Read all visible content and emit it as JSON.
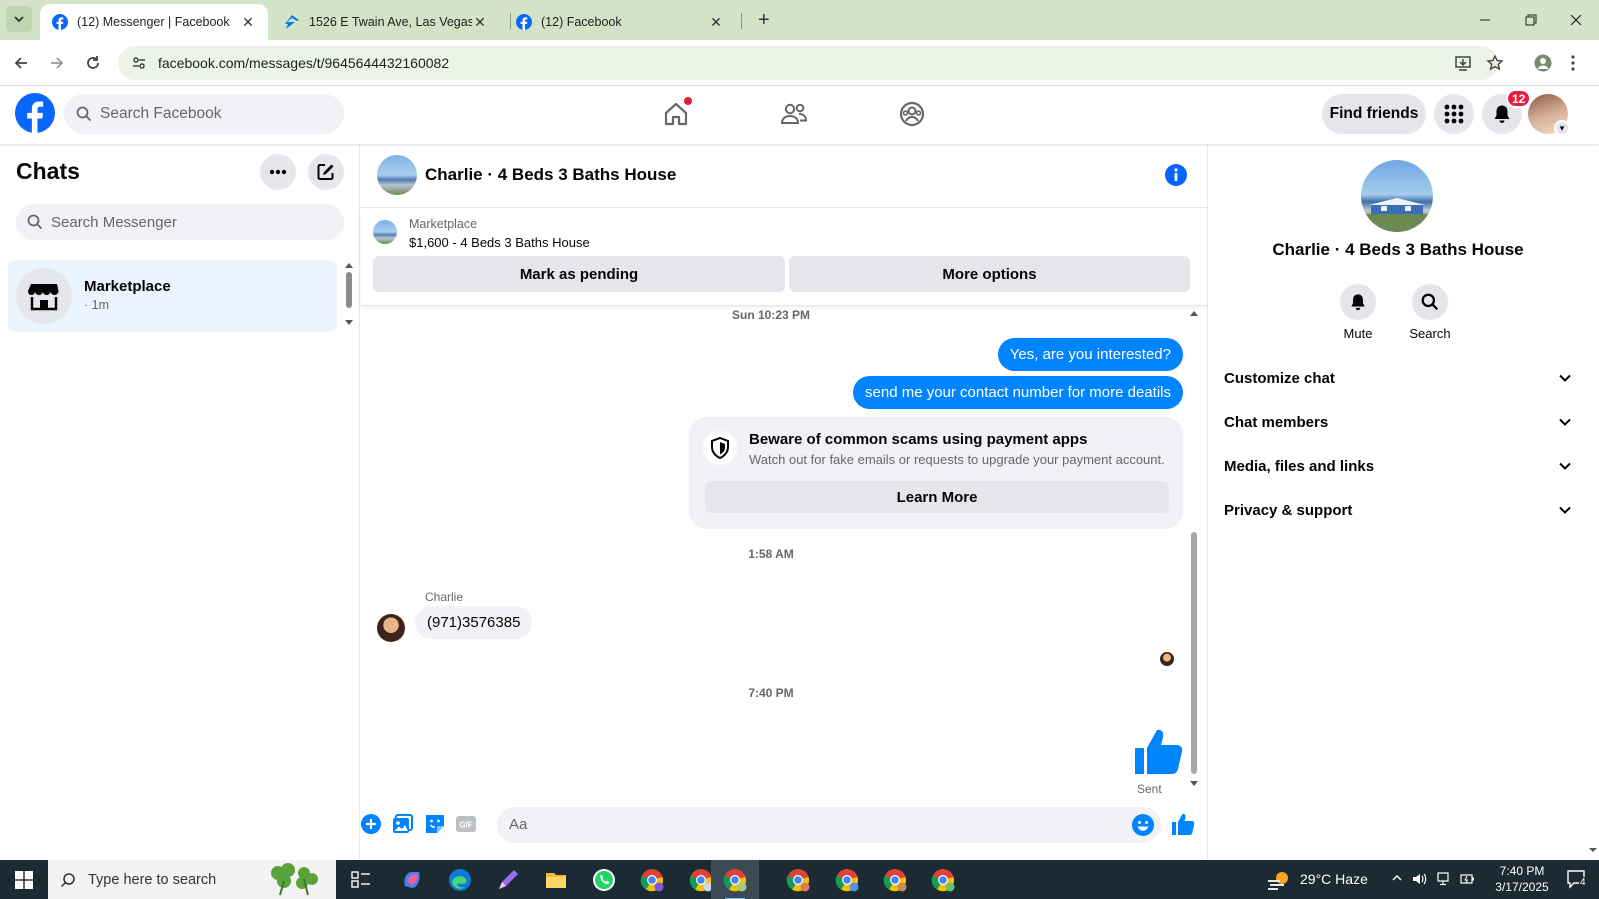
{
  "browser": {
    "tabs": [
      {
        "title": "(12) Messenger | Facebook",
        "active": true
      },
      {
        "title": "1526 E Twain Ave, Las Vegas, NV",
        "active": false
      },
      {
        "title": "(12) Facebook",
        "active": false
      }
    ],
    "url": "facebook.com/messages/t/9645644432160082"
  },
  "fbnav": {
    "search_placeholder": "Search Facebook",
    "find_friends": "Find friends",
    "notification_count": "12"
  },
  "chats": {
    "title": "Chats",
    "search_placeholder": "Search Messenger",
    "items": [
      {
        "name": "Marketplace",
        "time": "· 1m"
      }
    ]
  },
  "conversation": {
    "title": "Charlie · 4 Beds 3 Baths House",
    "marketplace_label": "Marketplace",
    "listing": "$1,600 - 4 Beds 3 Baths House",
    "mark_pending": "Mark as pending",
    "more_options": "More options",
    "messages": {
      "ts1": "Sun 10:23 PM",
      "out1": "Yes, are you interested?",
      "out2": "send me your contact number for more deatils",
      "scam_title": "Beware of common scams using payment apps",
      "scam_text": "Watch out for fake emails or requests to upgrade your payment account.",
      "learn_more": "Learn More",
      "ts2": "1:58 AM",
      "sender": "Charlie",
      "in1": "(971)3576385",
      "ts3": "7:40 PM",
      "sent": "Sent"
    },
    "composer_placeholder": "Aa"
  },
  "info_panel": {
    "name": "Charlie · 4 Beds 3 Baths House",
    "actions": [
      {
        "label": "Mute"
      },
      {
        "label": "Search"
      }
    ],
    "sections": [
      {
        "label": "Customize chat"
      },
      {
        "label": "Chat members"
      },
      {
        "label": "Media, files and links"
      },
      {
        "label": "Privacy & support"
      }
    ]
  },
  "taskbar": {
    "search_placeholder": "Type here to search",
    "weather": "29°C  Haze",
    "time": "7:40 PM",
    "date": "3/17/2025",
    "notifications": "4"
  },
  "colors": {
    "fb_blue": "#0866ff",
    "messenger_blue": "#0084ff",
    "badge_red": "#e41e3f"
  }
}
